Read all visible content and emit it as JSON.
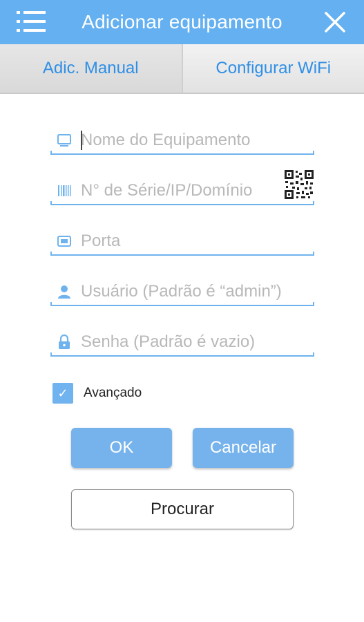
{
  "header": {
    "title": "Adicionar equipamento",
    "menu_icon": "hamburger-menu-icon",
    "close_icon": "close-icon",
    "color": "#64b0f0"
  },
  "tabs": [
    {
      "label": "Adic. Manual",
      "active": true
    },
    {
      "label": "Configurar WiFi",
      "active": false
    }
  ],
  "form": {
    "device_name": {
      "placeholder": "Nome do Equipamento",
      "value": "",
      "icon": "monitor-icon"
    },
    "serial": {
      "placeholder": "N° de Série/IP/Domínio",
      "value": "",
      "icon": "barcode-icon",
      "action_icon": "qr-code-icon"
    },
    "port": {
      "placeholder": "Porta",
      "value": "",
      "icon": "port-icon"
    },
    "user": {
      "placeholder": "Usuário (Padrão é “admin”)",
      "value": "",
      "icon": "user-icon"
    },
    "password": {
      "placeholder": "Senha (Padrão é vazio)",
      "value": "",
      "icon": "lock-icon"
    },
    "advanced": {
      "label": "Avançado",
      "checked": true
    }
  },
  "buttons": {
    "ok": "OK",
    "cancel": "Cancelar",
    "search": "Procurar"
  },
  "colors": {
    "accent": "#64b0f0",
    "tab_text": "#2f8fe6",
    "button": "#76b3ec"
  }
}
